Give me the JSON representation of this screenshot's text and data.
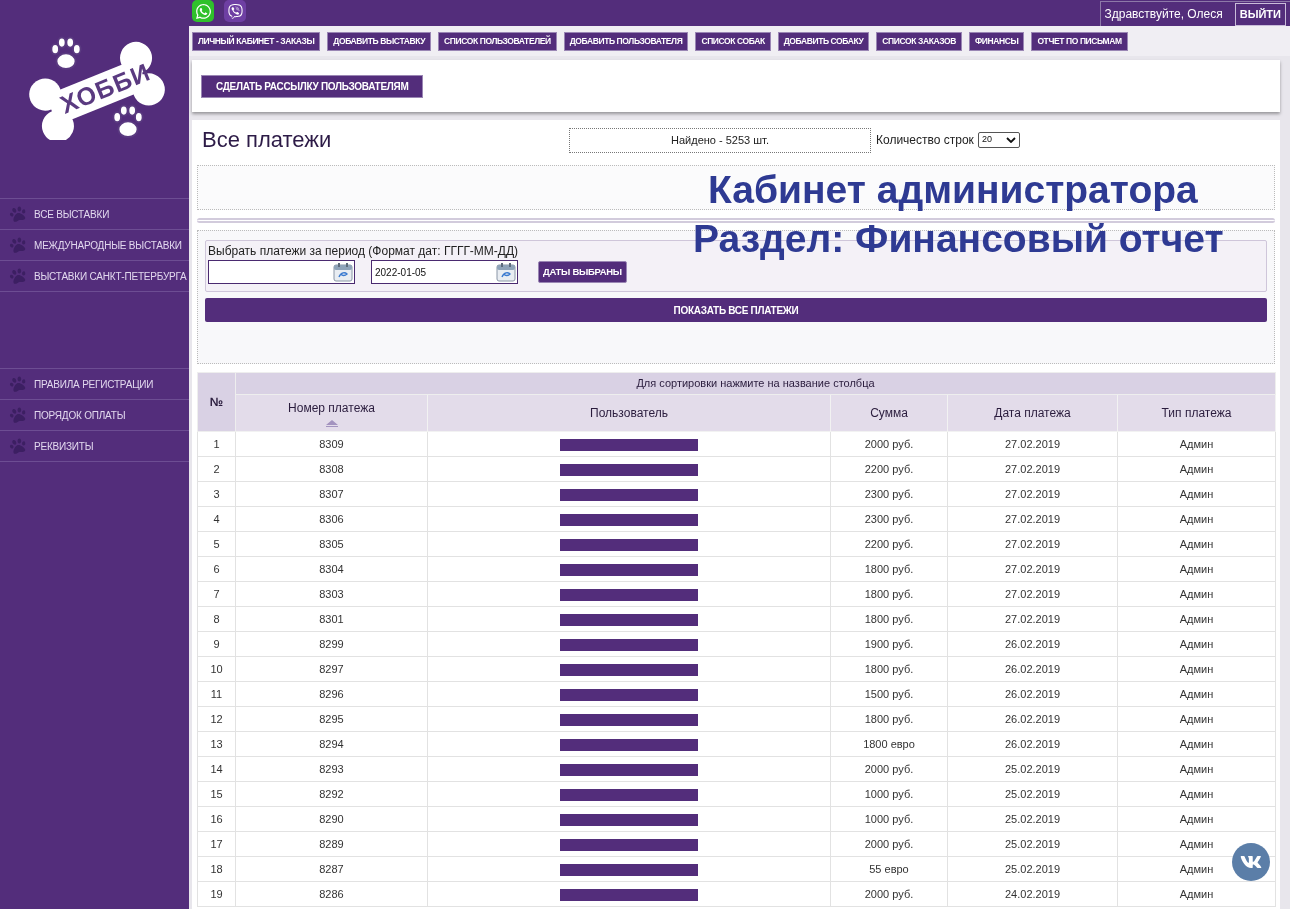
{
  "top_bar": {
    "greeting": "Здравствуйте, Олеся",
    "logout_button": "ВЫЙТИ"
  },
  "sidebar": {
    "logo_text": "ХОББИ",
    "sections": [
      {
        "items": [
          "ВСЕ ВЫСТАВКИ",
          "МЕЖДУНАРОДНЫЕ ВЫСТАВКИ",
          "ВЫСТАВКИ САНКТ-ПЕТЕРБУРГА"
        ]
      },
      {
        "items": [
          "ПРАВИЛА РЕГИСТРАЦИИ",
          "ПОРЯДОК ОПЛАТЫ",
          "РЕКВИЗИТЫ"
        ]
      }
    ]
  },
  "nav_buttons": [
    "ЛИЧНЫЙ КАБИНЕТ - ЗАКАЗЫ",
    "ДОБАВИТЬ ВЫСТАВКУ",
    "СПИСОК ПОЛЬЗОВАТЕЛЕЙ",
    "ДОБАВИТЬ ПОЛЬЗОВАТЕЛЯ",
    "СПИСОК СОБАК",
    "ДОБАВИТЬ СОБАКУ",
    "СПИСОК ЗАКАЗОВ",
    "ФИНАНСЫ",
    "ОТЧЕТ ПО ПИСЬМАМ"
  ],
  "mailing_button": "СДЕЛАТЬ РАССЫЛКУ ПОЛЬЗОВАТЕЛЯМ",
  "payments": {
    "title": "Все платежи",
    "found": "Найдено - 5253 шт.",
    "rows_label": "Количество строк",
    "rows_select": "20"
  },
  "overlay_caption": [
    "Кабинет администратора",
    "Раздел: Финансовый отчет"
  ],
  "filter": {
    "label": "Выбрать платежи за период (Формат дат: ГГГГ-ММ-ДД)",
    "date_to_value": "2022-01-05",
    "apply_button": "ДАТЫ ВЫБРАНЫ",
    "show_all_button": "ПОКАЗАТЬ ВСЕ ПЛАТЕЖИ"
  },
  "table": {
    "number_header": "№",
    "hint": "Для сортировки нажмите на название столбца",
    "columns": [
      {
        "label": "Номер платежа",
        "sorted": true
      },
      {
        "label": "Пользователь",
        "sorted": false
      },
      {
        "label": "Сумма",
        "sorted": false
      },
      {
        "label": "Дата платежа",
        "sorted": false
      },
      {
        "label": "Тип платежа",
        "sorted": false
      }
    ],
    "rows": [
      {
        "n": "1",
        "payment": "8309",
        "user_redacted": true,
        "amount": "2000 руб.",
        "date": "27.02.2019",
        "type": "Админ"
      },
      {
        "n": "2",
        "payment": "8308",
        "user_redacted": true,
        "amount": "2200 руб.",
        "date": "27.02.2019",
        "type": "Админ"
      },
      {
        "n": "3",
        "payment": "8307",
        "user_redacted": true,
        "amount": "2300 руб.",
        "date": "27.02.2019",
        "type": "Админ"
      },
      {
        "n": "4",
        "payment": "8306",
        "user_redacted": true,
        "amount": "2300 руб.",
        "date": "27.02.2019",
        "type": "Админ"
      },
      {
        "n": "5",
        "payment": "8305",
        "user_redacted": true,
        "amount": "2200 руб.",
        "date": "27.02.2019",
        "type": "Админ"
      },
      {
        "n": "6",
        "payment": "8304",
        "user_redacted": true,
        "amount": "1800 руб.",
        "date": "27.02.2019",
        "type": "Админ"
      },
      {
        "n": "7",
        "payment": "8303",
        "user_redacted": true,
        "amount": "1800 руб.",
        "date": "27.02.2019",
        "type": "Админ"
      },
      {
        "n": "8",
        "payment": "8301",
        "user_redacted": true,
        "amount": "1800 руб.",
        "date": "27.02.2019",
        "type": "Админ"
      },
      {
        "n": "9",
        "payment": "8299",
        "user_redacted": true,
        "amount": "1900 руб.",
        "date": "26.02.2019",
        "type": "Админ"
      },
      {
        "n": "10",
        "payment": "8297",
        "user_redacted": true,
        "amount": "1800 руб.",
        "date": "26.02.2019",
        "type": "Админ"
      },
      {
        "n": "11",
        "payment": "8296",
        "user_redacted": true,
        "amount": "1500 руб.",
        "date": "26.02.2019",
        "type": "Админ"
      },
      {
        "n": "12",
        "payment": "8295",
        "user_redacted": true,
        "amount": "1800 руб.",
        "date": "26.02.2019",
        "type": "Админ"
      },
      {
        "n": "13",
        "payment": "8294",
        "user_redacted": true,
        "amount": "1800 евро",
        "date": "26.02.2019",
        "type": "Админ"
      },
      {
        "n": "14",
        "payment": "8293",
        "user_redacted": true,
        "amount": "2000 руб.",
        "date": "25.02.2019",
        "type": "Админ"
      },
      {
        "n": "15",
        "payment": "8292",
        "user_redacted": true,
        "amount": "1000 руб.",
        "date": "25.02.2019",
        "type": "Админ"
      },
      {
        "n": "16",
        "payment": "8290",
        "user_redacted": true,
        "amount": "1000 руб.",
        "date": "25.02.2019",
        "type": "Админ"
      },
      {
        "n": "17",
        "payment": "8289",
        "user_redacted": true,
        "amount": "2000 руб.",
        "date": "25.02.2019",
        "type": "Админ"
      },
      {
        "n": "18",
        "payment": "8287",
        "user_redacted": true,
        "amount": "55 евро",
        "date": "25.02.2019",
        "type": "Админ"
      },
      {
        "n": "19",
        "payment": "8286",
        "user_redacted": true,
        "amount": "2000 руб.",
        "date": "24.02.2019",
        "type": "Админ"
      }
    ]
  }
}
